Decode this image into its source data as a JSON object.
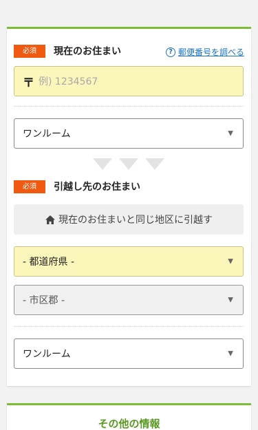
{
  "current_address": {
    "badge": "必須",
    "title": "現在のお住まい",
    "zip_lookup": {
      "icon": "question-circle-icon",
      "label": "郵便番号を調べる"
    },
    "postal": {
      "mark": "〒",
      "placeholder": "例) 1234567"
    },
    "room_type": {
      "value": "ワンルーム"
    }
  },
  "moving_address": {
    "badge": "必須",
    "title": "引越し先のお住まい",
    "same_area_button": {
      "icon": "home-icon",
      "label": "現在のお住まいと同じ地区に引越す"
    },
    "prefecture": {
      "value": "- 都道府県 -"
    },
    "city": {
      "value": "- 市区郡 -"
    },
    "room_type": {
      "value": "ワンルーム"
    }
  },
  "other_info": {
    "title": "その他の情報"
  },
  "dropdown_icon": "▼",
  "colors": {
    "accent_green": "#7cbd35",
    "badge_orange": "#f05a10",
    "link_blue": "#1c74c8",
    "highlight_yellow": "#fbf6ba"
  }
}
